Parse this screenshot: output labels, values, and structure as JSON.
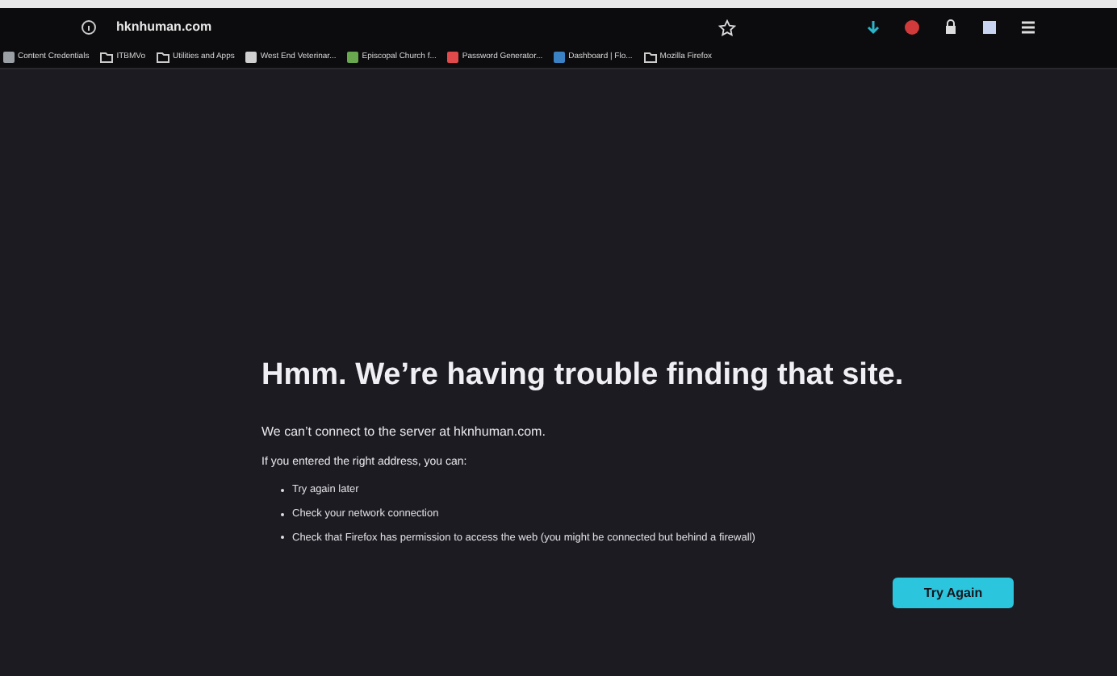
{
  "address_bar": {
    "url": "hknhuman.com"
  },
  "bookmarks": [
    {
      "label": "Content Credentials",
      "kind": "favicon",
      "color": "#9aa0a6"
    },
    {
      "label": "ITBMVo",
      "kind": "folder"
    },
    {
      "label": "Utilities and Apps",
      "kind": "folder"
    },
    {
      "label": "West End Veterinar...",
      "kind": "favicon",
      "color": "#d0d0d0"
    },
    {
      "label": "Episcopal Church f...",
      "kind": "favicon",
      "color": "#6aa84f"
    },
    {
      "label": "Password Generator...",
      "kind": "favicon",
      "color": "#e04a4a"
    },
    {
      "label": "Dashboard | Flo...",
      "kind": "favicon",
      "color": "#3b82c4"
    },
    {
      "label": "Mozilla Firefox",
      "kind": "folder"
    }
  ],
  "error": {
    "title": "Hmm. We’re having trouble finding that site.",
    "message": "We can’t connect to the server at hknhuman.com.",
    "hint": "If you entered the right address, you can:",
    "suggestions": [
      "Try again later",
      "Check your network connection",
      "Check that Firefox has permission to access the web (you might be connected but behind a firewall)"
    ],
    "button": "Try Again"
  }
}
